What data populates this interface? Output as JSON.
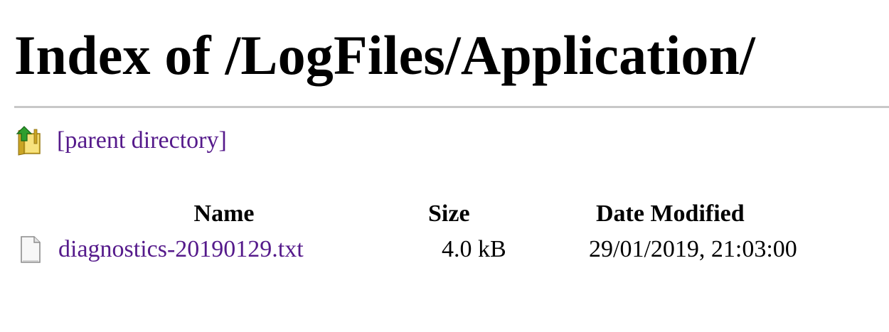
{
  "page": {
    "title": "Index of /LogFiles/Application/"
  },
  "parent": {
    "icon": "folder-up-arrow-icon",
    "label": "[parent directory]"
  },
  "table": {
    "headers": {
      "name": "Name",
      "size": "Size",
      "date": "Date Modified"
    },
    "rows": [
      {
        "icon": "text-file-icon",
        "name": "diagnostics-20190129.txt",
        "size": "4.0 kB",
        "date": "29/01/2019, 21:03:00"
      }
    ]
  },
  "colors": {
    "link": "#551a8b",
    "divider": "#c8c8c8",
    "folder_icon": "#e8c84a",
    "arrow_icon": "#2e9e2e"
  }
}
